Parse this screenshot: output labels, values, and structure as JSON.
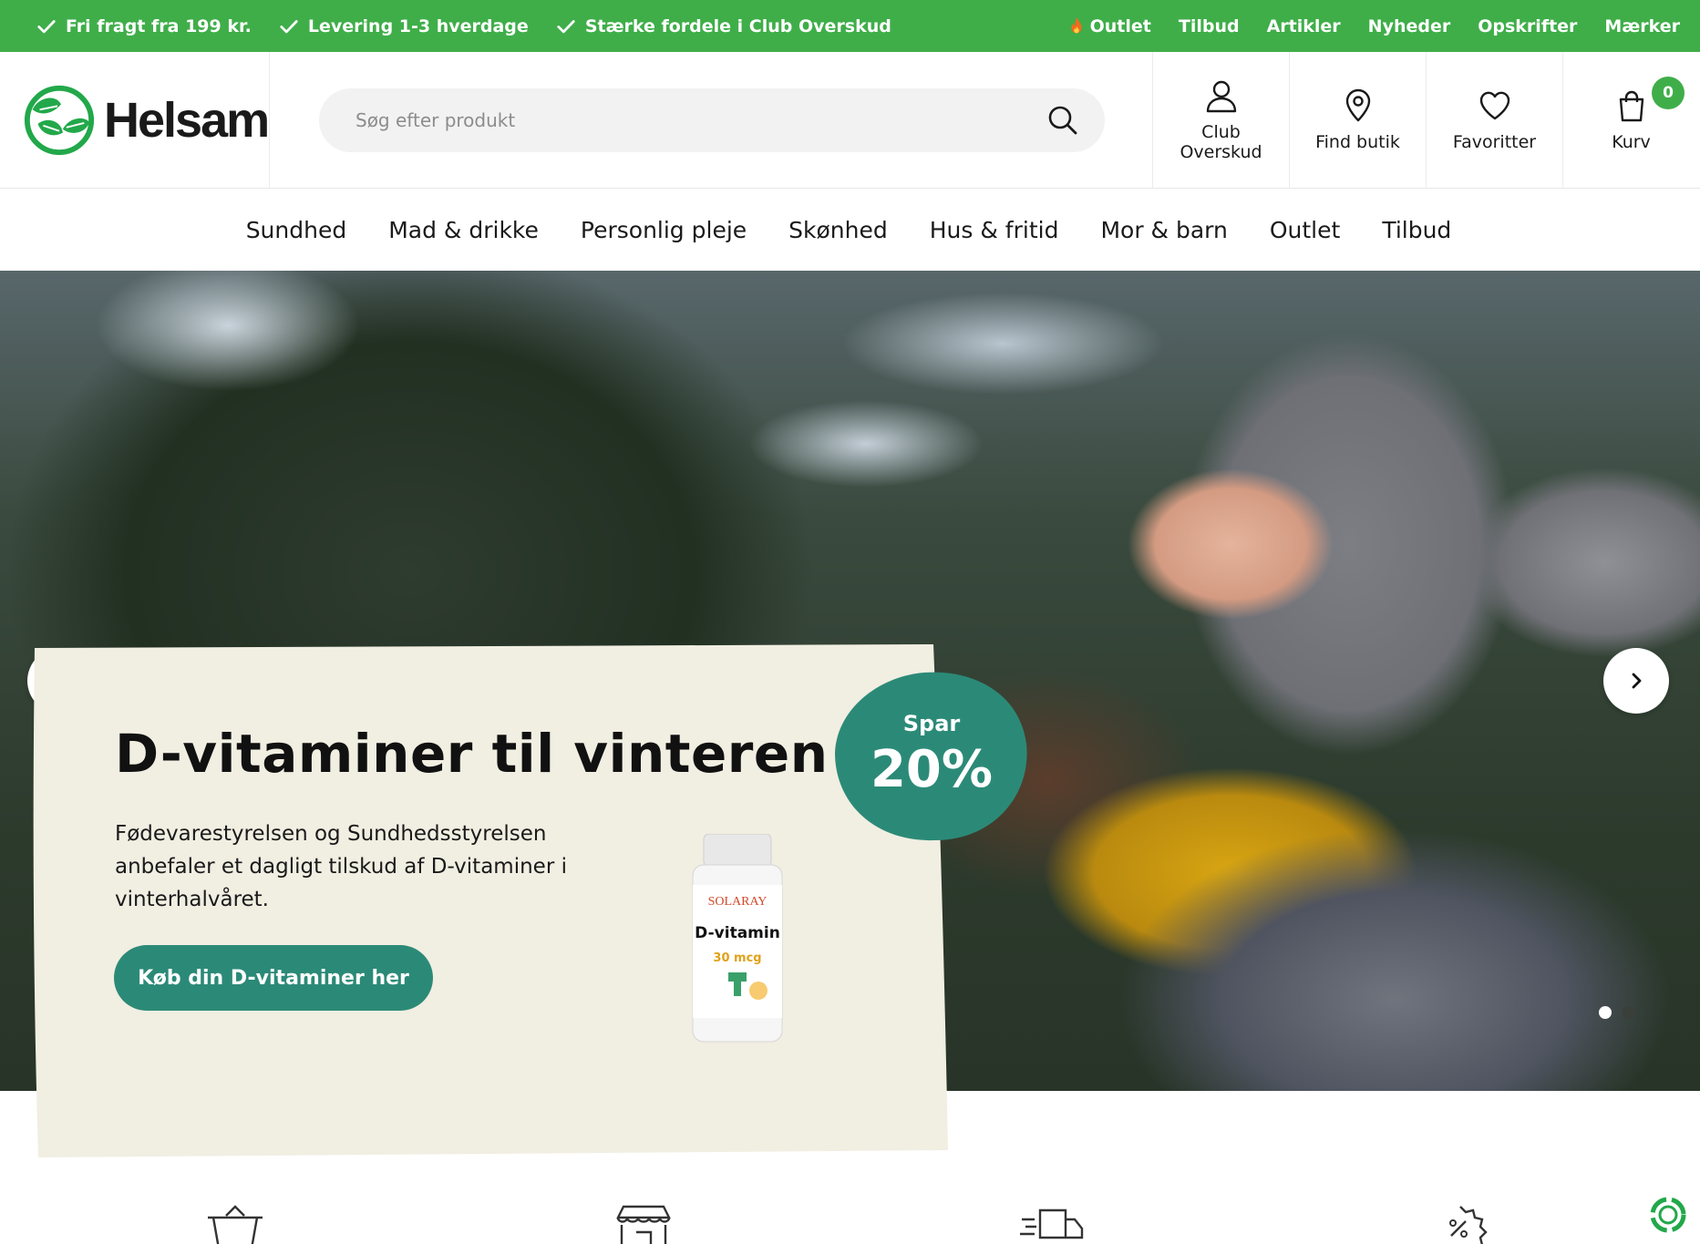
{
  "topbar": {
    "usps": [
      {
        "label": "Fri fragt fra 199 kr."
      },
      {
        "label": "Levering 1-3 hverdage"
      },
      {
        "label": "Stærke fordele i Club Overskud"
      }
    ],
    "links": [
      {
        "label": "Outlet",
        "icon": "flame-icon"
      },
      {
        "label": "Tilbud"
      },
      {
        "label": "Artikler"
      },
      {
        "label": "Nyheder"
      },
      {
        "label": "Opskrifter"
      },
      {
        "label": "Mærker"
      }
    ],
    "color": "#3fae49"
  },
  "header": {
    "logo_text": "Helsam",
    "search": {
      "placeholder": "Søg efter produkt",
      "value": ""
    },
    "actions": [
      {
        "label": "Club Overskud",
        "icon": "user-icon"
      },
      {
        "label": "Find butik",
        "icon": "location-pin-icon"
      },
      {
        "label": "Favoritter",
        "icon": "heart-icon"
      },
      {
        "label": "Kurv",
        "icon": "shopping-bag-icon",
        "badge": "0"
      }
    ]
  },
  "nav": {
    "items": [
      {
        "label": "Sundhed"
      },
      {
        "label": "Mad & drikke"
      },
      {
        "label": "Personlig pleje"
      },
      {
        "label": "Skønhed"
      },
      {
        "label": "Hus & fritid"
      },
      {
        "label": "Mor & barn"
      },
      {
        "label": "Outlet"
      },
      {
        "label": "Tilbud"
      }
    ]
  },
  "hero": {
    "title": "D-vitaminer til vinteren",
    "description": "Fødevarestyrelsen og Sundhedsstyrelsen anbefaler et dagligt tilskud af D-vitaminer i vinterhalvåret.",
    "cta": "Køb din D-vitaminer her",
    "badge": {
      "top": "Spar",
      "value": "20%"
    },
    "product": {
      "brand": "SOLARAY",
      "name": "D-vitamin",
      "dose": "30 mcg"
    },
    "slides_total": 2,
    "slide_active": 1,
    "accent_color": "#2b8a77",
    "card_color": "#f1eee2"
  }
}
